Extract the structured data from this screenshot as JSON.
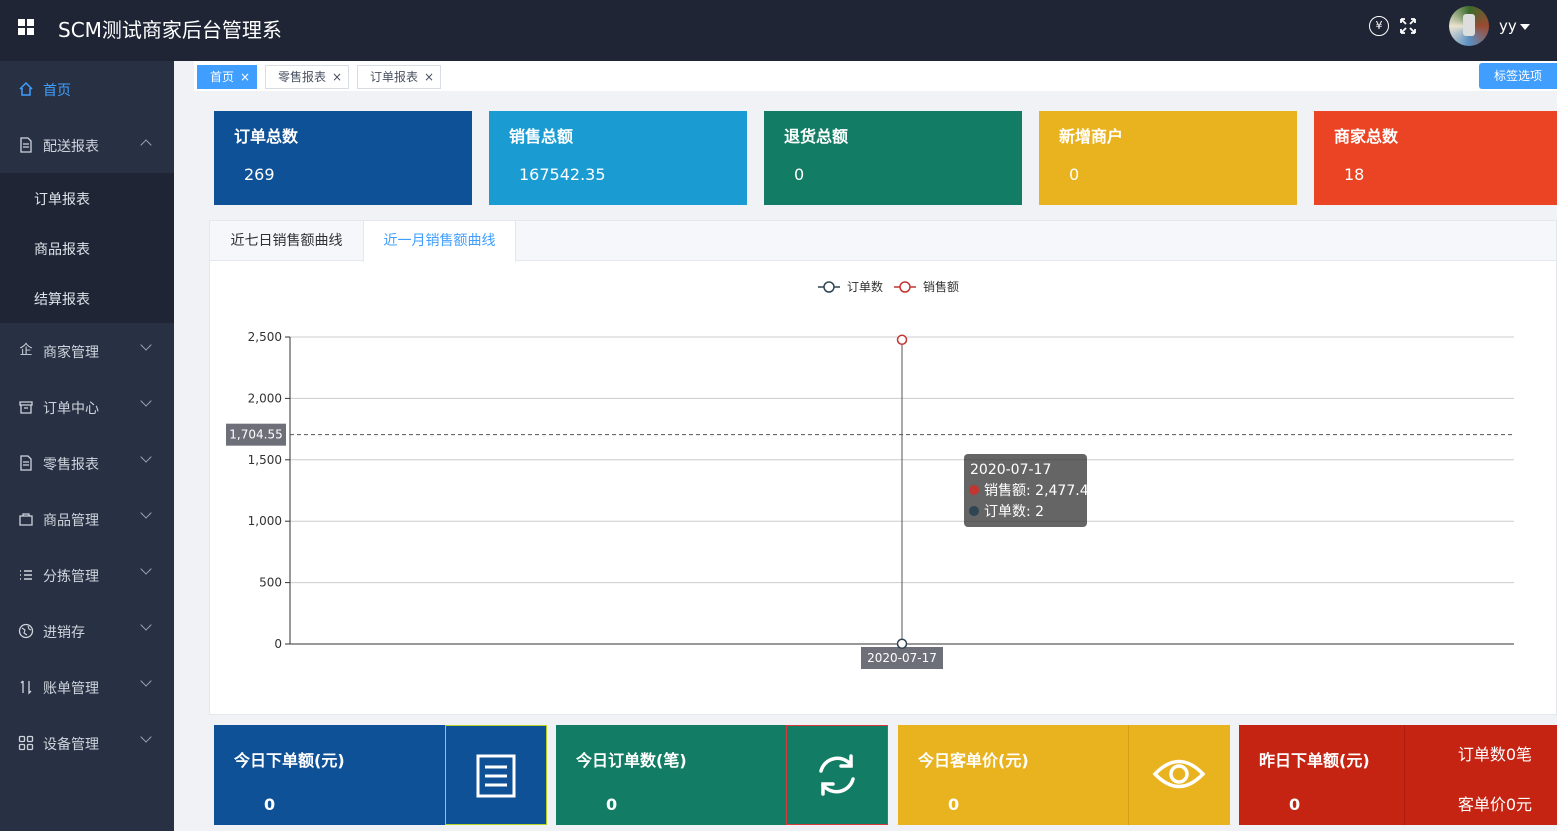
{
  "header": {
    "title": "SCM测试商家后台管理系",
    "username": "yy",
    "icons": [
      "grid-icon",
      "yen-icon",
      "fullscreen-icon",
      "avatar",
      "caret-down-icon"
    ]
  },
  "sidebar": {
    "items": [
      {
        "label": "首页",
        "icon": "home-icon"
      },
      {
        "label": "配送报表",
        "icon": "document-icon"
      },
      {
        "label": "商家管理",
        "icon": "building-icon"
      },
      {
        "label": "订单中心",
        "icon": "box-icon"
      },
      {
        "label": "零售报表",
        "icon": "document-icon"
      },
      {
        "label": "商品管理",
        "icon": "bag-icon"
      },
      {
        "label": "分拣管理",
        "icon": "list-icon"
      },
      {
        "label": "进销存",
        "icon": "globe-icon"
      },
      {
        "label": "账单管理",
        "icon": "sort-icon"
      },
      {
        "label": "设备管理",
        "icon": "apps-icon"
      }
    ],
    "submenu": [
      "订单报表",
      "商品报表",
      "结算报表"
    ]
  },
  "tabs": {
    "items": [
      {
        "label": "首页",
        "close": "×"
      },
      {
        "label": "零售报表",
        "close": "×"
      },
      {
        "label": "订单报表",
        "close": "×"
      }
    ],
    "options_label": "标签选项"
  },
  "stats": [
    {
      "title": "订单总数",
      "value": "269",
      "color": "#0f5197"
    },
    {
      "title": "销售总额",
      "value": "167542.35",
      "color": "#1a9cd3"
    },
    {
      "title": "退货总额",
      "value": "0",
      "color": "#137c64"
    },
    {
      "title": "新增商户",
      "value": "0",
      "color": "#e9b320"
    },
    {
      "title": "商家总数",
      "value": "18",
      "color": "#ea4424"
    }
  ],
  "chart_tabs": [
    "近七日销售额曲线",
    "近一月销售额曲线"
  ],
  "chart_data": {
    "type": "line",
    "x": [
      "2020-07-17"
    ],
    "series": [
      {
        "name": "订单数",
        "values": [
          2
        ],
        "color": "#2f4554"
      },
      {
        "name": "销售额",
        "values": [
          2477.4
        ],
        "color": "#c23531"
      }
    ],
    "ylim": [
      0,
      2500
    ],
    "yticks": [
      "0",
      "500",
      "1,000",
      "1,500",
      "2,000",
      "2,500"
    ],
    "legend": "top-center",
    "grid": true,
    "axis_pointer": {
      "y_label": "1,704.55",
      "x_label": "2020-07-17"
    },
    "tooltip": {
      "title": "2020-07-17",
      "lines": [
        "销售额: 2,477.4",
        "订单数: 2"
      ]
    }
  },
  "widgets": [
    {
      "title": "今日下单额(元)",
      "value": "0",
      "icon": "document-icon",
      "color": "#0f5197"
    },
    {
      "title": "今日订单数(笔)",
      "value": "0",
      "icon": "refresh-icon",
      "color": "#137c64"
    },
    {
      "title": "今日客单价(元)",
      "value": "0",
      "icon": "eye-icon",
      "color": "#e9b320"
    },
    {
      "title": "昨日下单额(元)",
      "value": "0",
      "color": "#c52412",
      "lines": [
        "订单数0笔",
        "客单价0元"
      ]
    }
  ]
}
